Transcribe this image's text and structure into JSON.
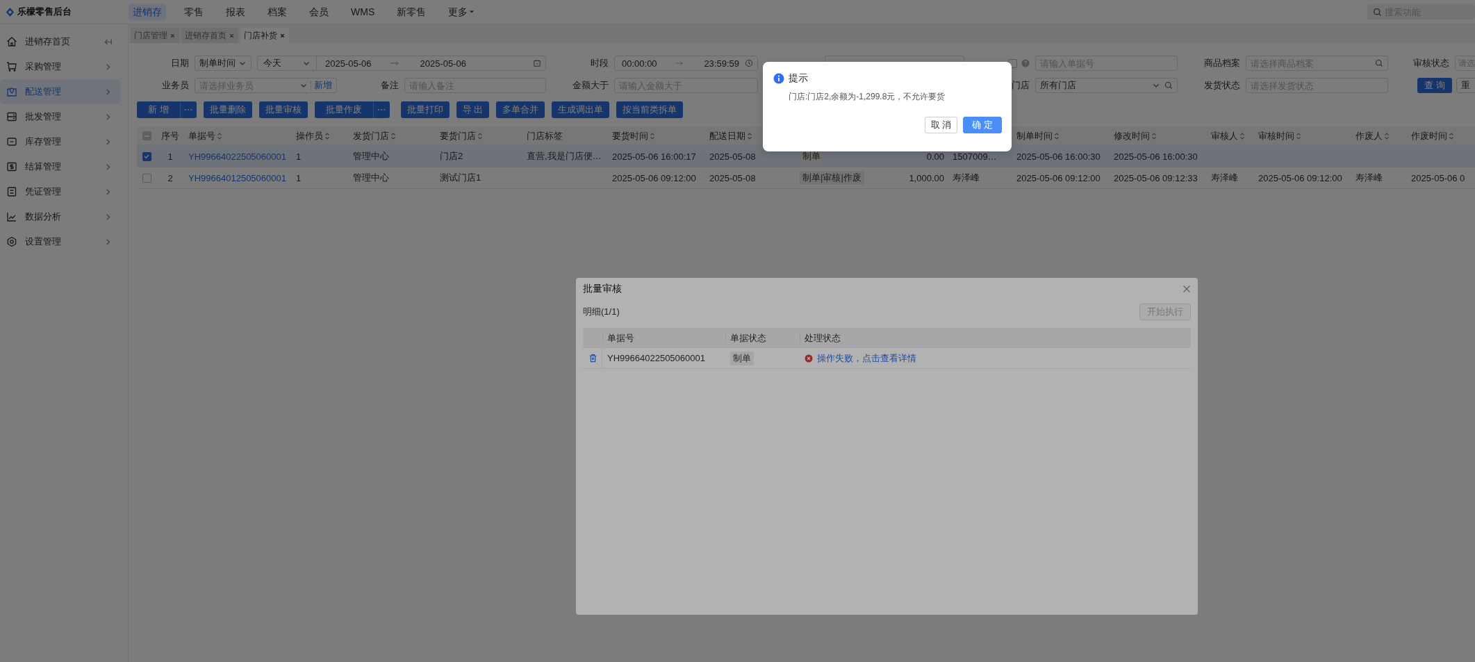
{
  "app": {
    "name": "乐檬零售后台"
  },
  "top_menu": [
    {
      "label": "进销存",
      "selected": true,
      "kind": "link"
    },
    {
      "label": "零售",
      "selected": false,
      "kind": "link"
    },
    {
      "label": "报表",
      "selected": false,
      "kind": "link"
    },
    {
      "label": "档案",
      "selected": false,
      "kind": "link"
    },
    {
      "label": "会员",
      "selected": false,
      "kind": "link"
    },
    {
      "label": "WMS",
      "selected": false,
      "kind": "link"
    },
    {
      "label": "新零售",
      "selected": false,
      "kind": "link"
    },
    {
      "label": "更多",
      "selected": false,
      "kind": "dropdown"
    }
  ],
  "search": {
    "placeholder": "搜索功能"
  },
  "sidebar": {
    "items": [
      {
        "label": "进销存首页",
        "selected": false,
        "kind": "home"
      },
      {
        "label": "采购管理",
        "selected": false,
        "kind": "group"
      },
      {
        "label": "配送管理",
        "selected": true,
        "kind": "group"
      },
      {
        "label": "批发管理",
        "selected": false,
        "kind": "group"
      },
      {
        "label": "库存管理",
        "selected": false,
        "kind": "group"
      },
      {
        "label": "结算管理",
        "selected": false,
        "kind": "group"
      },
      {
        "label": "凭证管理",
        "selected": false,
        "kind": "group"
      },
      {
        "label": "数据分析",
        "selected": false,
        "kind": "group"
      },
      {
        "label": "设置管理",
        "selected": false,
        "kind": "group"
      }
    ]
  },
  "tabs": [
    {
      "label": "门店管理",
      "selected": false
    },
    {
      "label": "进销存首页",
      "selected": false
    },
    {
      "label": "门店补货",
      "selected": true
    }
  ],
  "filters": {
    "date": {
      "label": "日期",
      "type_value": "制单时间",
      "preset": "今天",
      "from": "2025-05-06",
      "to": "2025-05-06"
    },
    "period": {
      "label": "时段",
      "from": "00:00:00",
      "to": "23:59:59"
    },
    "order_no": {
      "placeholder": "请输入单据号",
      "checked": false
    },
    "goods": {
      "label": "商品档案",
      "placeholder": "请选择商品档案"
    },
    "audit_status": {
      "label": "审核状态",
      "placeholder": "请选"
    },
    "salesman": {
      "label": "业务员",
      "placeholder": "请选择业务员",
      "add_link": "新增"
    },
    "remark": {
      "label": "备注",
      "placeholder": "请输入备注"
    },
    "amount_min": {
      "label": "金额大于",
      "placeholder": "请输入金额大于"
    },
    "store": {
      "label": "门店",
      "value": "所有门店"
    },
    "ship_status": {
      "label": "发货状态",
      "placeholder": "请选择发货状态"
    },
    "query_button": "查 询",
    "reset_button": "重"
  },
  "toolbar": {
    "groups": [
      [
        {
          "label": "新 增",
          "more": true
        },
        {
          "label": "批量删除",
          "more": false
        },
        {
          "label": "批量审核",
          "more": false
        },
        {
          "label": "批量作废",
          "more": true
        }
      ],
      [
        {
          "label": "批量打印",
          "more": false
        },
        {
          "label": "导 出",
          "more": false
        },
        {
          "label": "多单合并",
          "more": false
        },
        {
          "label": "生成调出单",
          "more": false
        },
        {
          "label": "按当前类拆单",
          "more": false
        }
      ]
    ]
  },
  "table": {
    "select_all": {
      "checked": false,
      "indeterminate": true
    },
    "columns": [
      {
        "label": "序号",
        "sortable": false
      },
      {
        "label": "单据号",
        "sortable": true
      },
      {
        "label": "操作员",
        "sortable": true
      },
      {
        "label": "发货门店",
        "sortable": true
      },
      {
        "label": "要货门店",
        "sortable": true
      },
      {
        "label": "门店标签",
        "sortable": false
      },
      {
        "label": "要货时间",
        "sortable": true
      },
      {
        "label": "配送日期",
        "sortable": true
      },
      {},
      {},
      {},
      {
        "label": "制单时间",
        "sortable": true
      },
      {
        "label": "修改时间",
        "sortable": true
      },
      {
        "label": "审核人",
        "sortable": true
      },
      {
        "label": "审核时间",
        "sortable": true
      },
      {
        "label": "作废人",
        "sortable": true
      },
      {
        "label": "作废时间",
        "sortable": true
      }
    ],
    "rows": [
      {
        "selected": true,
        "no": "1",
        "order_no": "YH99664022505060001",
        "operator": "1",
        "ship_store": "管理中心",
        "req_store": "门店2",
        "store_tag": "直营,我是门店便…",
        "req_time": "2025-05-06 16:00:17",
        "delivery_date": "2025-05-08",
        "status": "制单",
        "amount": "0.00",
        "column_12": "1507009…",
        "created": "2025-05-06 16:00:30",
        "modified": "2025-05-06 16:00:30"
      },
      {
        "selected": false,
        "no": "2",
        "order_no": "YH99664012505060001",
        "operator": "1",
        "ship_store": "管理中心",
        "req_store": "测试门店1",
        "req_time": "2025-05-06 09:12:00",
        "delivery_date": "2025-05-08",
        "status": "制单|审核|作废",
        "amount": "1,000.00",
        "column_12": "寿泽峰",
        "created": "2025-05-06 09:12:00",
        "modified": "2025-05-06 09:12:33",
        "auditor": "寿泽峰",
        "audit_time": "2025-05-06 09:12:00",
        "voider": "寿泽峰",
        "void_time": "2025-05-06 0"
      }
    ]
  },
  "batch_dialog": {
    "title": "批量审核",
    "detail_label": "明细(1/1)",
    "start_button": {
      "label": "开始执行",
      "disabled": true
    },
    "columns": [
      "单据号",
      "单据状态",
      "处理状态"
    ],
    "rows": [
      {
        "order_no": "YH99664022505060001",
        "status": "制单",
        "result": "操作失败，点击查看详情",
        "failed": true
      }
    ]
  },
  "prompt": {
    "title": "提示",
    "message": "门店:门店2,余额为-1,299.8元，不允许要货",
    "buttons": [
      {
        "label": "取 消",
        "kind": "default"
      },
      {
        "label": "确 定",
        "kind": "primary"
      }
    ]
  }
}
